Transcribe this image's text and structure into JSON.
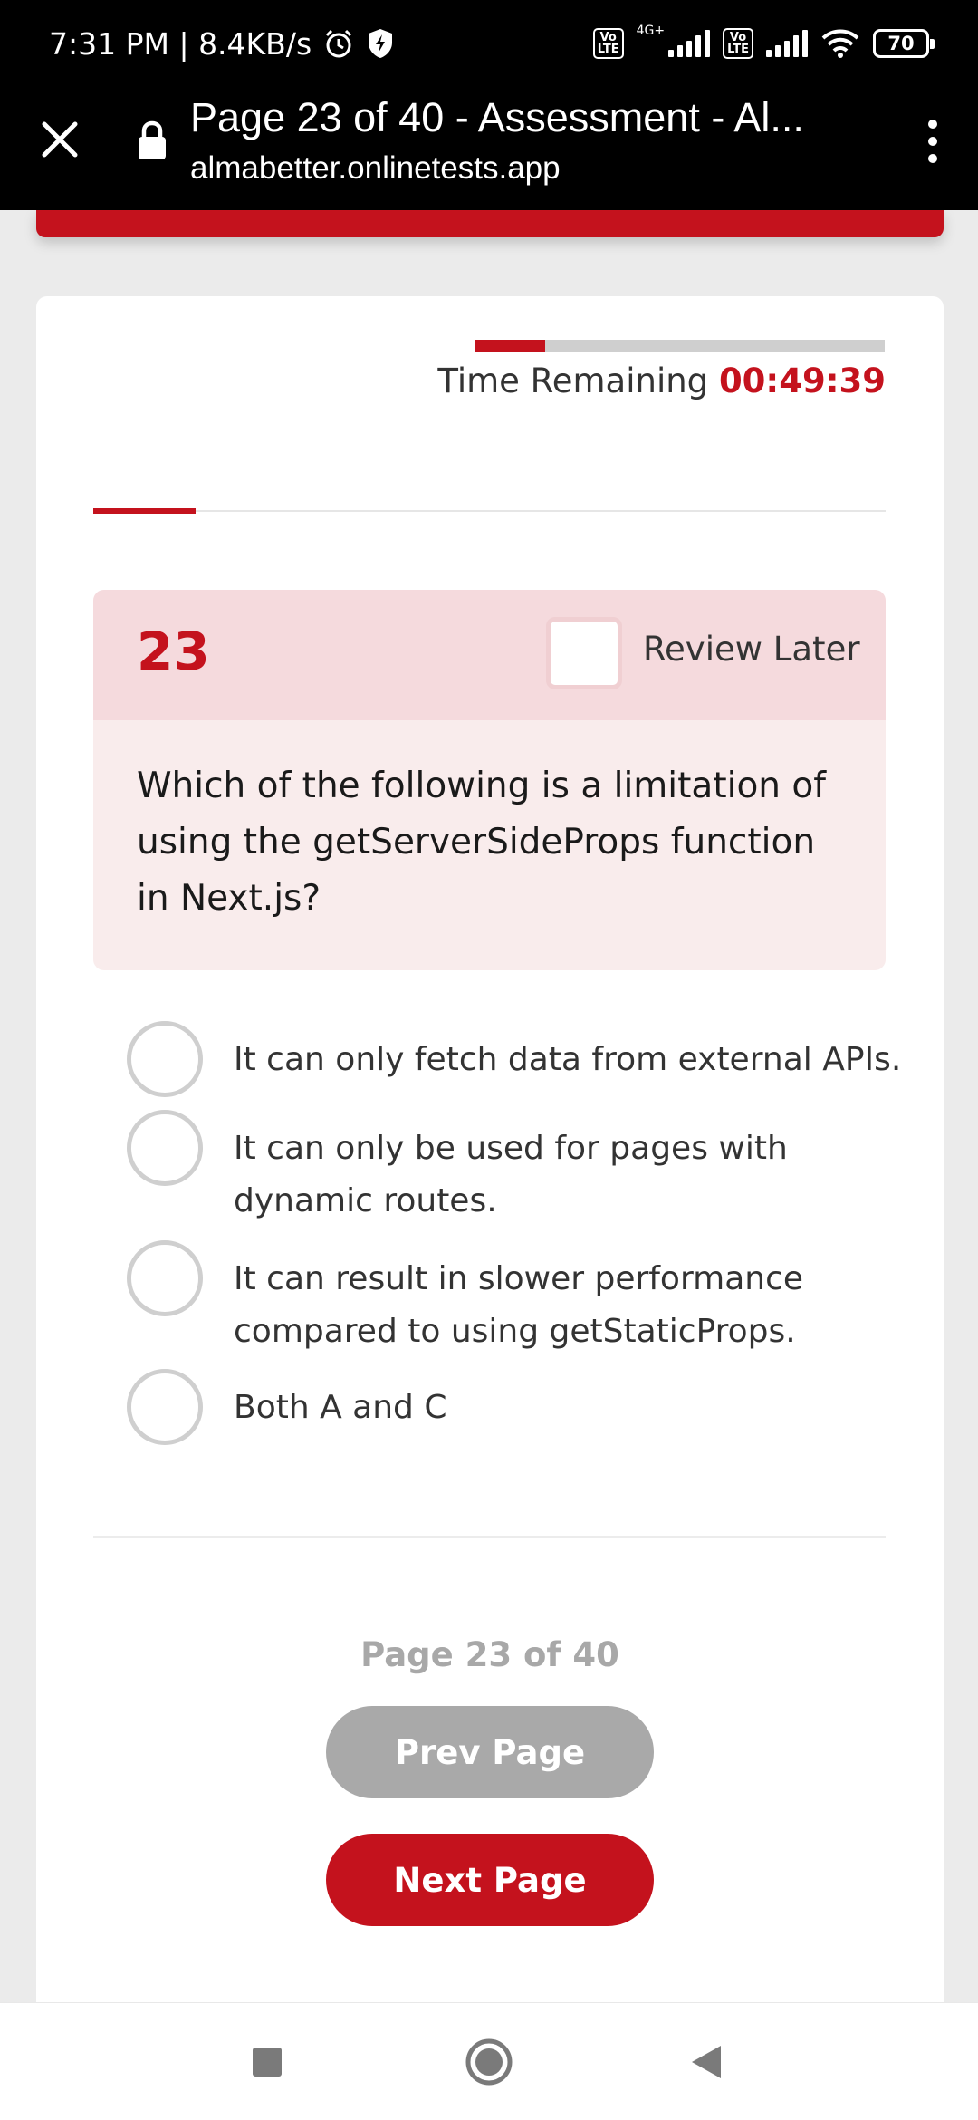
{
  "status_bar": {
    "time_speed": "7:31 PM | 8.4KB/s",
    "network_type": "4G+",
    "lte_label": "Vo LTE",
    "battery_level": "70"
  },
  "browser": {
    "title": "Page 23 of 40 - Assessment - Al...",
    "url": "almabetter.onlinetests.app"
  },
  "timer": {
    "label": "Time Remaining",
    "value": "00:49:39",
    "progress_fraction": 0.17
  },
  "question": {
    "number": "23",
    "review_label": "Review Later",
    "review_checked": false,
    "text": "Which of the following is a limitation of using the getServerSideProps function in Next.js?"
  },
  "options": [
    {
      "label": "It can only fetch data from external APIs.",
      "selected": false
    },
    {
      "label": "It can only be used for pages with dynamic routes.",
      "selected": false
    },
    {
      "label": "It can result in slower performance compared to using getStaticProps.",
      "selected": false
    },
    {
      "label": "Both A and C",
      "selected": false
    }
  ],
  "pagination": {
    "indicator": "Page 23 of 40",
    "prev_label": "Prev Page",
    "next_label": "Next Page"
  },
  "colors": {
    "accent": "#c4121d",
    "question_head_bg": "#f5dadd",
    "question_body_bg": "#f9ecec",
    "disabled_button": "#a9a9a9"
  },
  "icons": {
    "close": "close-icon",
    "lock": "lock-icon",
    "menu": "more-vertical-icon",
    "nav_recents": "square-icon",
    "nav_home": "circle-icon",
    "nav_back": "triangle-back-icon"
  }
}
